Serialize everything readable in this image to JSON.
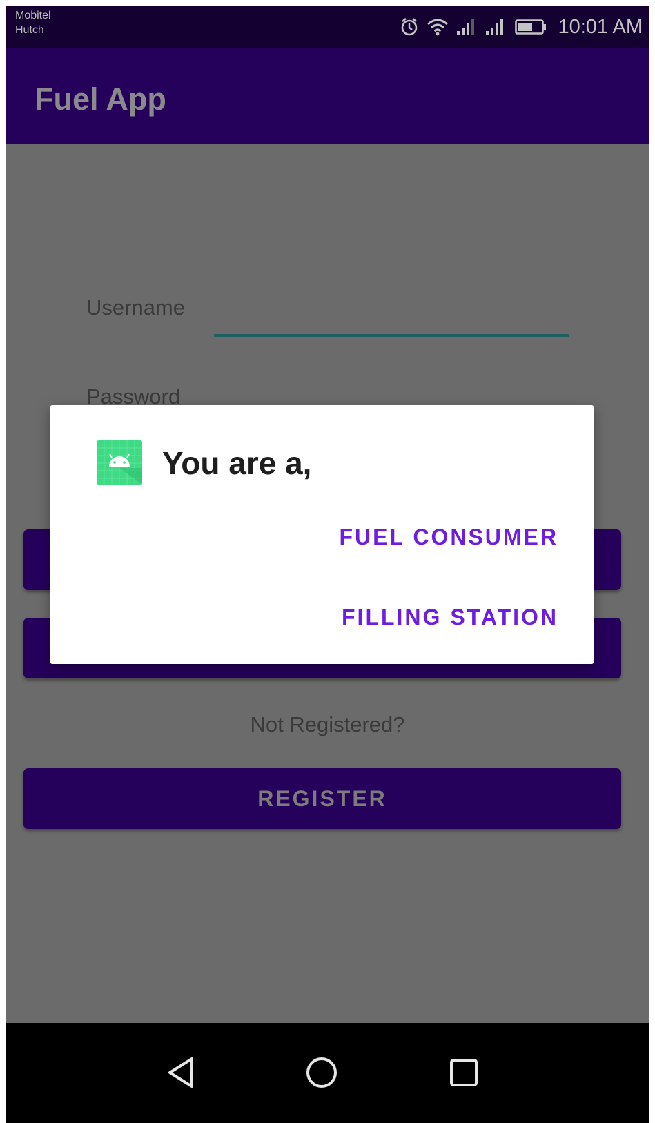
{
  "status_bar": {
    "carrier_1": "Mobitel",
    "carrier_2": "Hutch",
    "time": "10:01 AM",
    "icons": [
      "alarm-icon",
      "wifi-icon",
      "signal-icon",
      "signal-icon",
      "battery-icon"
    ]
  },
  "app_bar": {
    "title": "Fuel App"
  },
  "form": {
    "username_label": "Username",
    "username_value": "",
    "password_label": "Password",
    "not_registered": "Not Registered?",
    "register_label": "REGISTER"
  },
  "dialog": {
    "icon": "android-app-icon",
    "title": "You are a,",
    "options": [
      {
        "label": "FUEL CONSUMER"
      },
      {
        "label": "FILLING STATION"
      }
    ]
  },
  "nav_bar": {
    "icons": [
      "back-icon",
      "home-icon",
      "recents-icon"
    ]
  },
  "colors": {
    "primary": "#26015c",
    "status_bar": "#140131",
    "accent": "#6e1de0",
    "input_underline": "#1f5e63",
    "scrim_background": "#6b6b6b"
  }
}
